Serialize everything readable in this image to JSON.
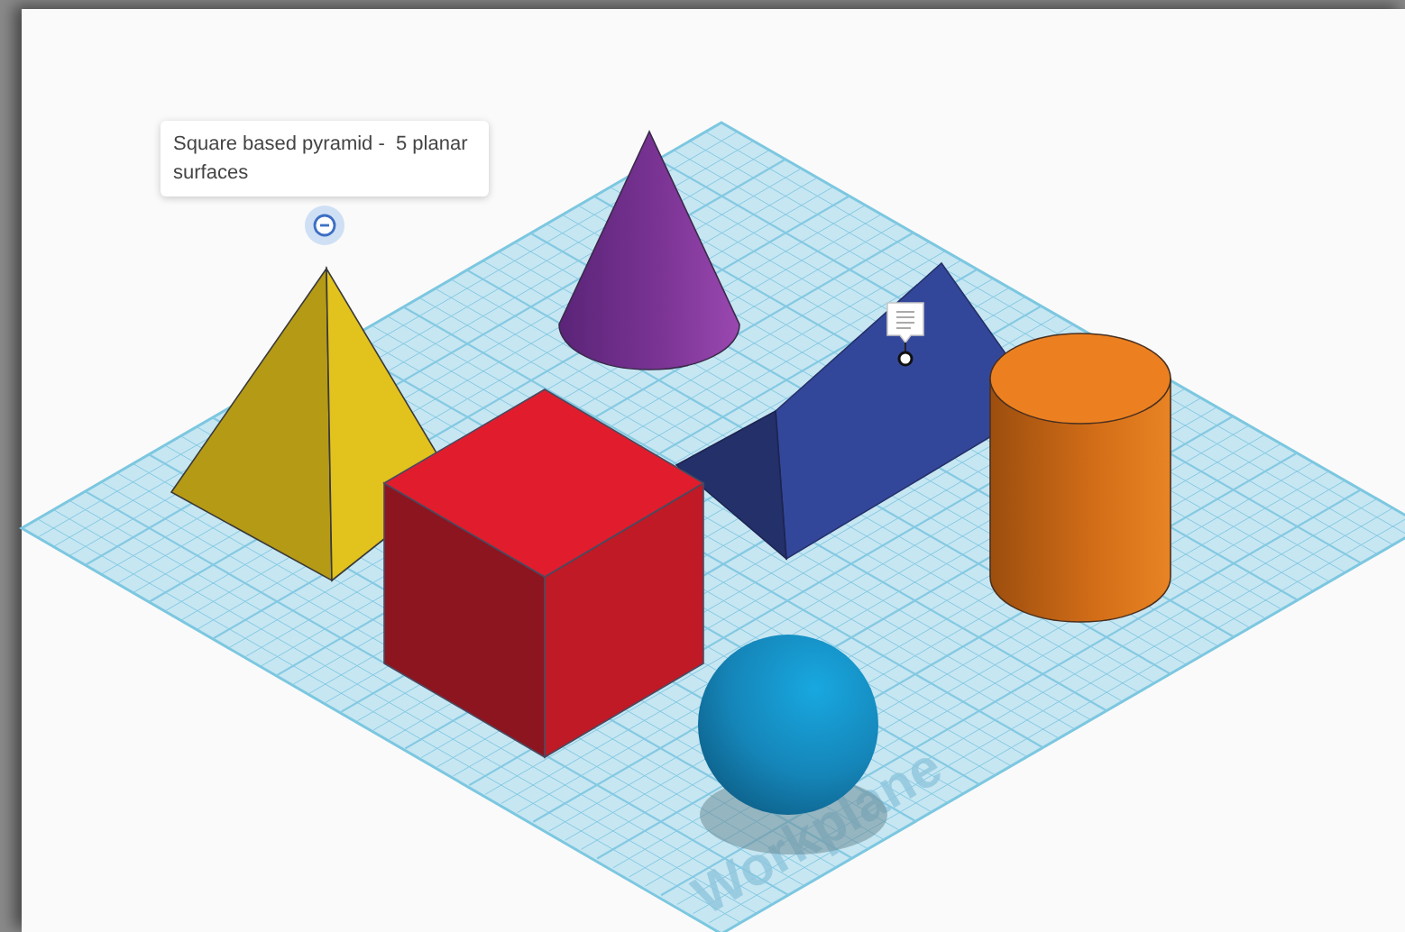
{
  "tooltip": {
    "text": "Square based pyramid -  5 planar surfaces"
  },
  "workplane": {
    "label": "Workplane"
  }
}
